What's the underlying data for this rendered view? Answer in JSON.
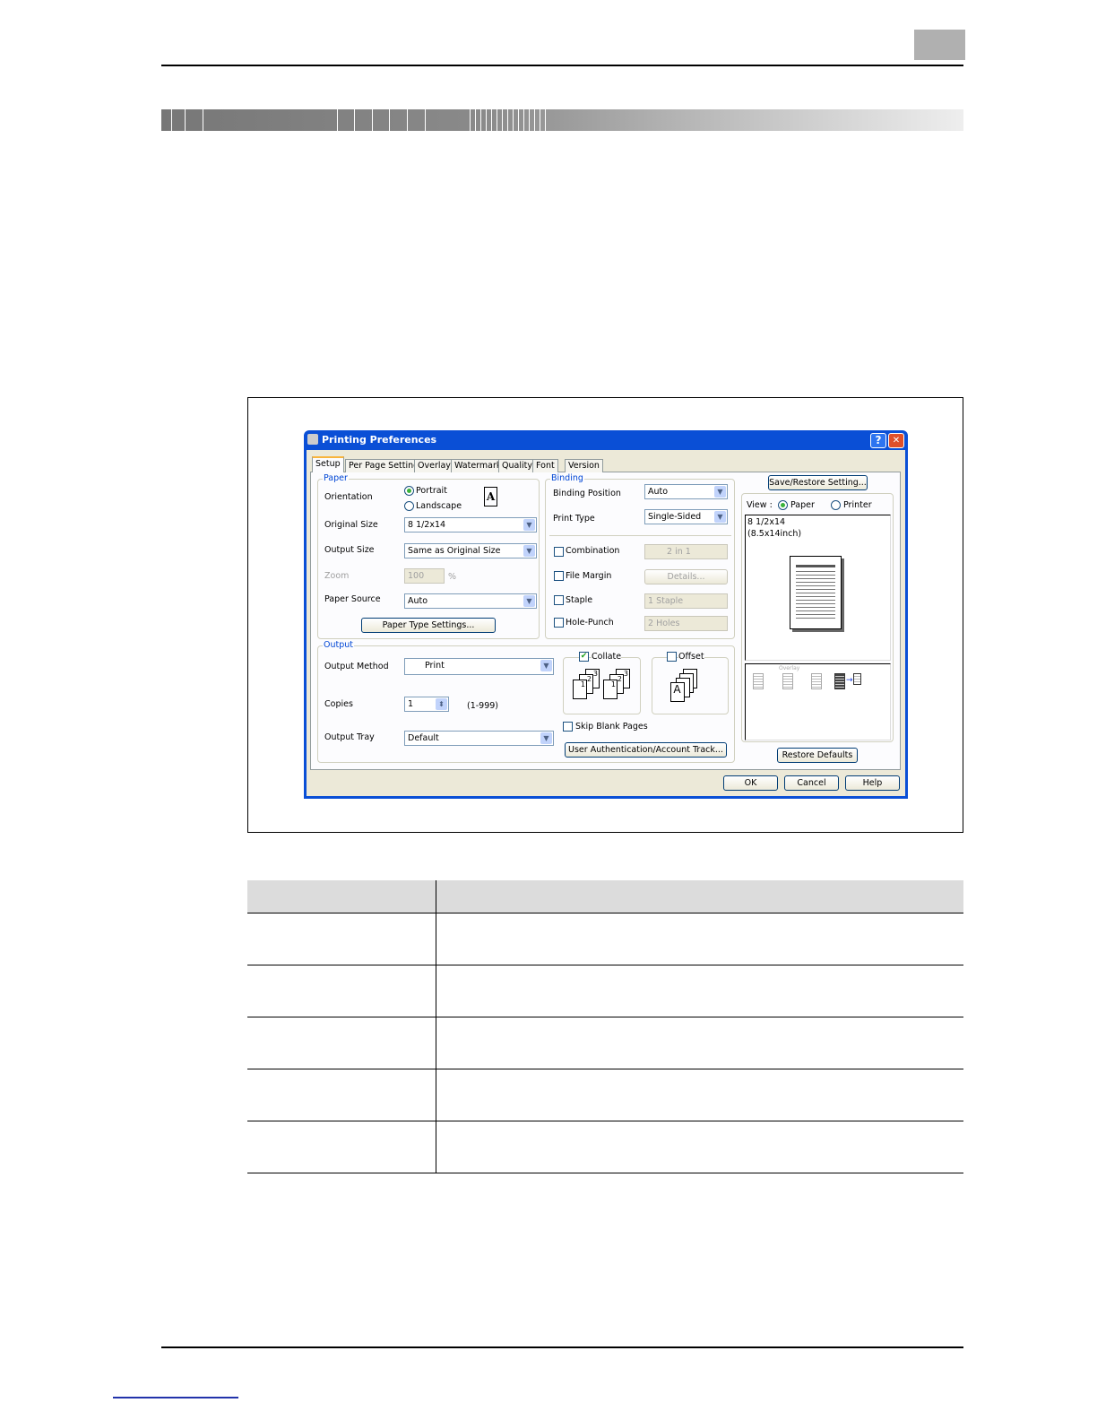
{
  "dialog": {
    "title": "Printing Preferences",
    "help_btn": "?",
    "close_btn": "✕",
    "tabs": [
      "Setup",
      "Per Page Setting",
      "Overlay",
      "Watermark",
      "Quality",
      "Font",
      "Version"
    ],
    "paper": {
      "group_label": "Paper",
      "orientation_label": "Orientation",
      "portrait": "Portrait",
      "landscape": "Landscape",
      "orientation_icon_letter": "A",
      "original_size_label": "Original Size",
      "original_size_value": "8 1/2x14",
      "output_size_label": "Output Size",
      "output_size_value": "Same as Original Size",
      "zoom_label": "Zoom",
      "zoom_value": "100",
      "zoom_unit": "%",
      "paper_source_label": "Paper Source",
      "paper_source_value": "Auto",
      "paper_type_button": "Paper Type Settings..."
    },
    "binding": {
      "group_label": "Binding",
      "binding_position_label": "Binding Position",
      "binding_position_value": "Auto",
      "print_type_label": "Print Type",
      "print_type_value": "Single-Sided",
      "combination_label": "Combination",
      "combination_value": "2 in 1",
      "file_margin_label": "File Margin",
      "details_button": "Details...",
      "staple_label": "Staple",
      "staple_value": "1 Staple",
      "hole_punch_label": "Hole-Punch",
      "hole_punch_value": "2 Holes"
    },
    "output": {
      "group_label": "Output",
      "output_method_label": "Output Method",
      "output_method_value": "Print",
      "copies_label": "Copies",
      "copies_value": "1",
      "copies_range": "(1-999)",
      "output_tray_label": "Output Tray",
      "output_tray_value": "Default",
      "collate_label": "Collate",
      "offset_label": "Offset",
      "skip_blank_label": "Skip Blank Pages",
      "user_auth_button": "User Authentication/Account Track..."
    },
    "preview": {
      "save_restore_button": "Save/Restore Setting...",
      "view_label": "View :",
      "view_paper": "Paper",
      "view_printer": "Printer",
      "paper_name": "8 1/2x14",
      "paper_dims": "(8.5x14inch)",
      "overlay_icon_text": "Overlay",
      "restore_defaults_button": "Restore Defaults"
    },
    "ok_button": "OK",
    "cancel_button": "Cancel",
    "help_button": "Help"
  }
}
